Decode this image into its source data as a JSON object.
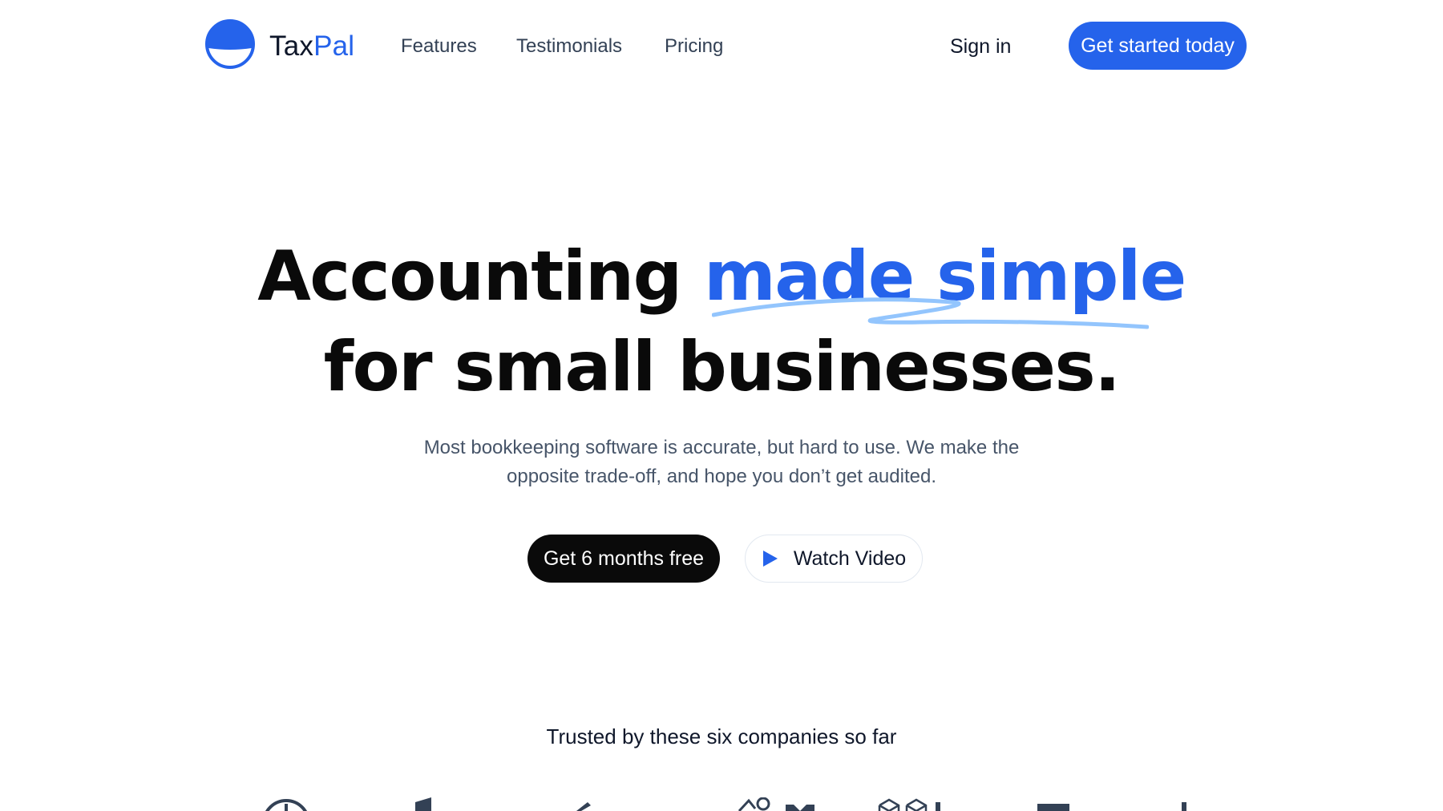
{
  "brand": {
    "name_main": "Tax",
    "name_accent": "Pal"
  },
  "nav": {
    "items": [
      "Features",
      "Testimonials",
      "Pricing"
    ]
  },
  "header": {
    "signin_label": "Sign in",
    "cta_label": "Get started today"
  },
  "hero": {
    "title_part1": "Accounting ",
    "title_highlight": "made simple",
    "title_line2": "for small businesses.",
    "subtitle": "Most bookkeeping software is accurate, but hard to use. We make the opposite trade-off, and hope you don’t get audited.",
    "primary_button": "Get 6 months free",
    "secondary_button": "Watch Video"
  },
  "trusted": {
    "label": "Trusted by these six companies so far"
  },
  "colors": {
    "accent": "#2563eb",
    "dark": "#0a0a0a",
    "muted": "#475569",
    "scribble": "#93c5fd"
  },
  "icons": {
    "logo": "half-circle-logo-icon",
    "play": "play-icon"
  }
}
